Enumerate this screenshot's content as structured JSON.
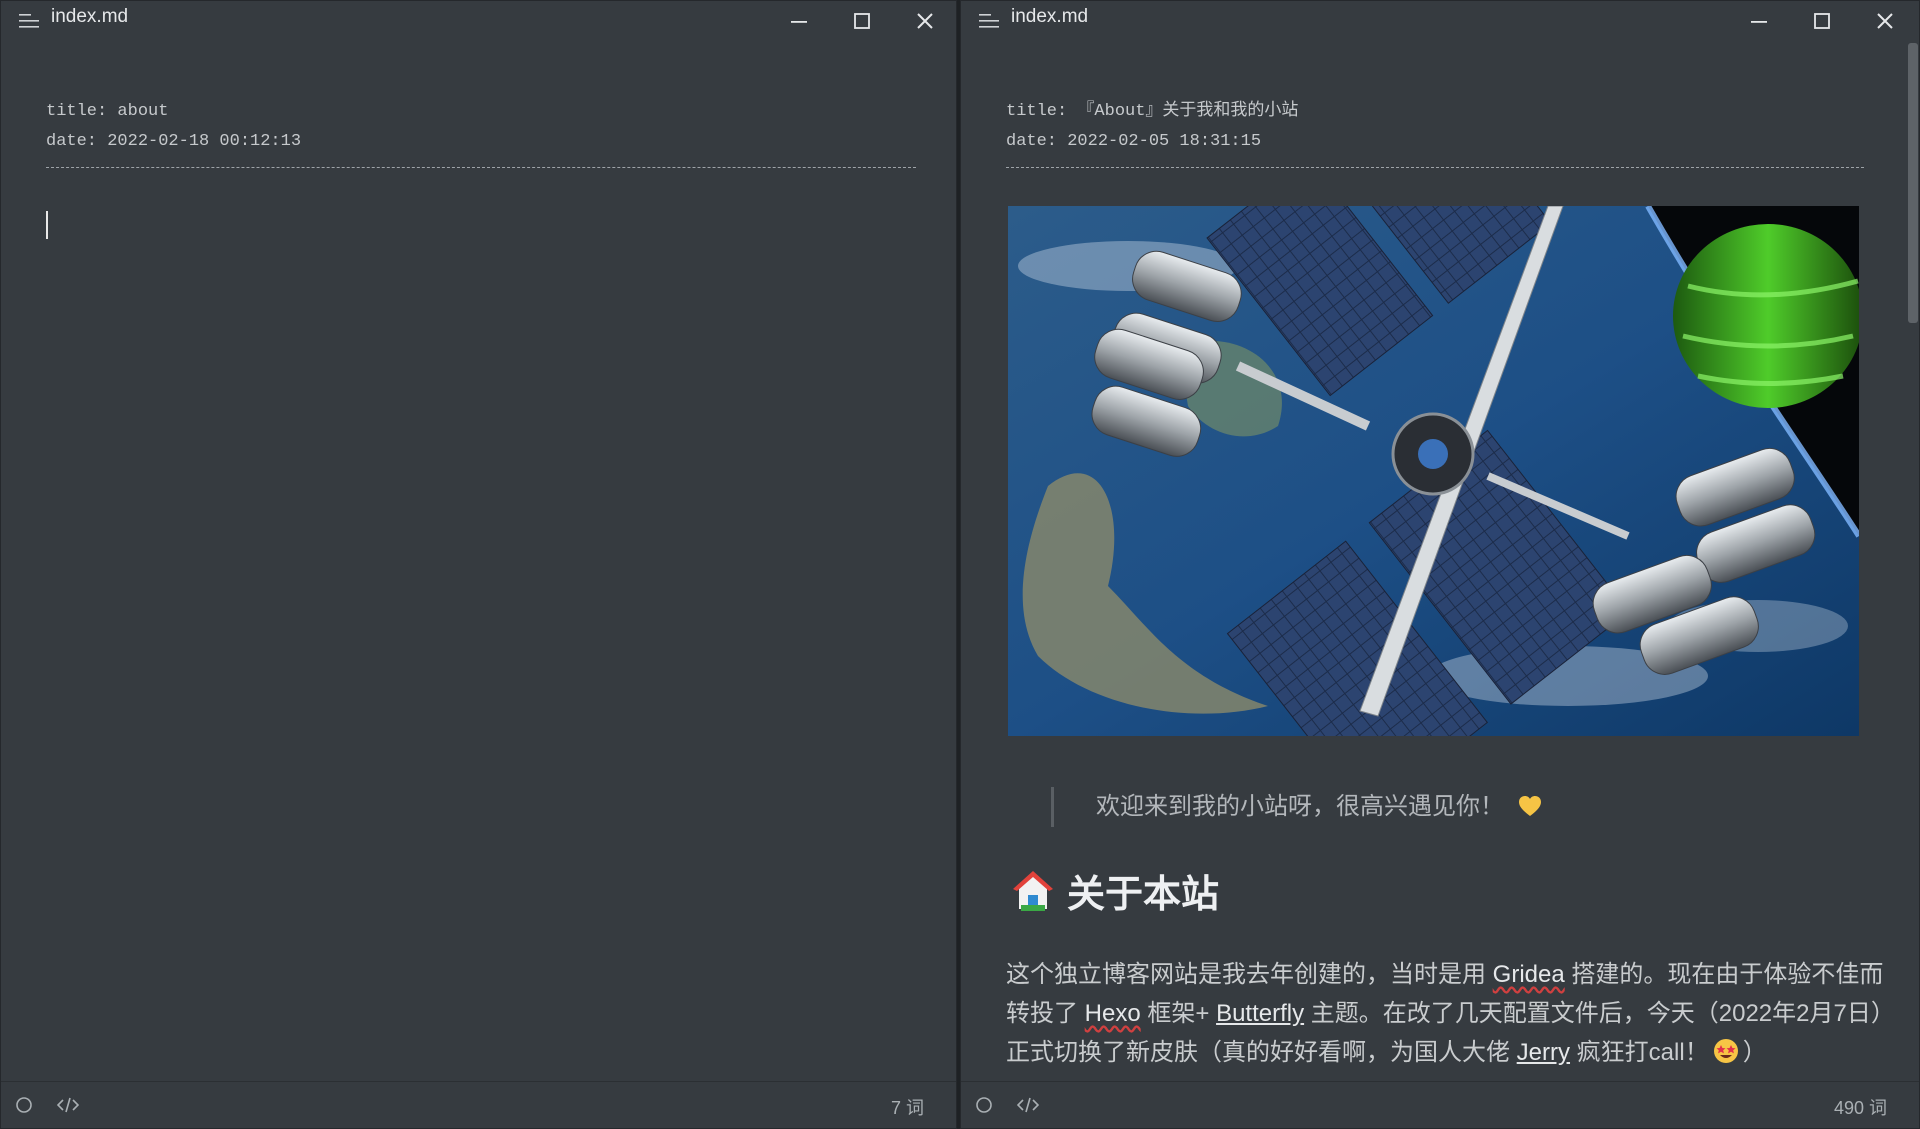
{
  "left_window": {
    "title": "index.md",
    "front_matter": {
      "title_line": "title: about",
      "date_line": "date: 2022-02-18 00:12:13"
    },
    "status": {
      "word_count": "7 词"
    }
  },
  "right_window": {
    "title": "index.md",
    "front_matter": {
      "title_line": "title: 『About』关于我和我的小站",
      "date_line": "date: 2022-02-05 18:31:15"
    },
    "blockquote": "欢迎来到我的小站呀，很高兴遇见你！",
    "heading": "关于本站",
    "paragraph": {
      "t1": "这个独立博客网站是我去年创建的，当时是用 ",
      "link_gridea": "Gridea",
      "t2": " 搭建的。现在由于体验不佳而转投了 ",
      "link_hexo": "Hexo",
      "t3": " 框架+ ",
      "link_butterfly": "Butterfly",
      "t4": " 主题。在改了几天配置文件后，今天（2022年2月7日）正式切换了新皮肤（真的好好看啊，为国人大佬 ",
      "link_jerry": "Jerry",
      "t5": " 疯狂打call！",
      "t6": "）"
    },
    "status": {
      "word_count": "490 词"
    }
  },
  "icons": {
    "menu": "outline-menu-icon",
    "minimize": "minimize-icon",
    "maximize": "maximize-icon",
    "close": "close-icon",
    "circle": "circle-status-icon",
    "source": "source-code-icon",
    "heart": "yellow-heart-icon",
    "house": "house-icon",
    "star_eyes": "star-struck-face-icon"
  },
  "colors": {
    "editor_bg": "#363b40",
    "text": "#c9ccce",
    "misspell_underline": "#d04040"
  }
}
